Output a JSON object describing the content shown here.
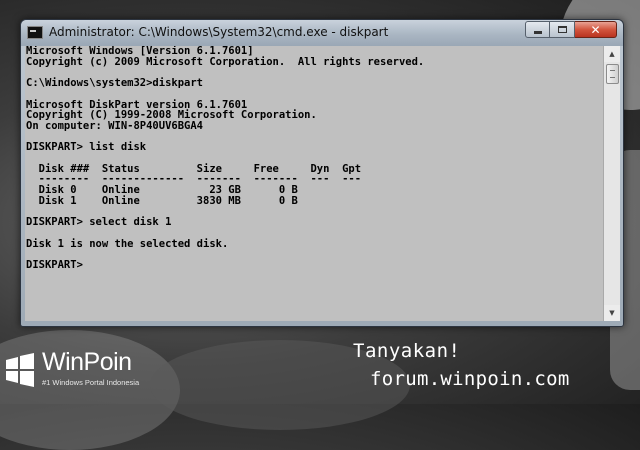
{
  "window": {
    "title": "Administrator: C:\\Windows\\System32\\cmd.exe - diskpart",
    "close_symbol": "✕"
  },
  "console": {
    "lines": [
      "Microsoft Windows [Version 6.1.7601]",
      "Copyright (c) 2009 Microsoft Corporation.  All rights reserved.",
      "",
      "C:\\Windows\\system32>diskpart",
      "",
      "Microsoft DiskPart version 6.1.7601",
      "Copyright (C) 1999-2008 Microsoft Corporation.",
      "On computer: WIN-8P40UV6BGA4",
      "",
      "DISKPART> list disk",
      "",
      "  Disk ###  Status         Size     Free     Dyn  Gpt",
      "  --------  -------------  -------  -------  ---  ---",
      "  Disk 0    Online           23 GB      0 B",
      "  Disk 1    Online         3830 MB      0 B",
      "",
      "DISKPART> select disk 1",
      "",
      "Disk 1 is now the selected disk.",
      "",
      "DISKPART>"
    ]
  },
  "branding": {
    "name": "WinPoin",
    "tagline": "#1 Windows Portal Indonesia",
    "ask": "Tanyakan!",
    "forum": "forum.winpoin.com"
  },
  "icons": {
    "app": "cmd-icon",
    "logo": "windows-logo-icon"
  }
}
